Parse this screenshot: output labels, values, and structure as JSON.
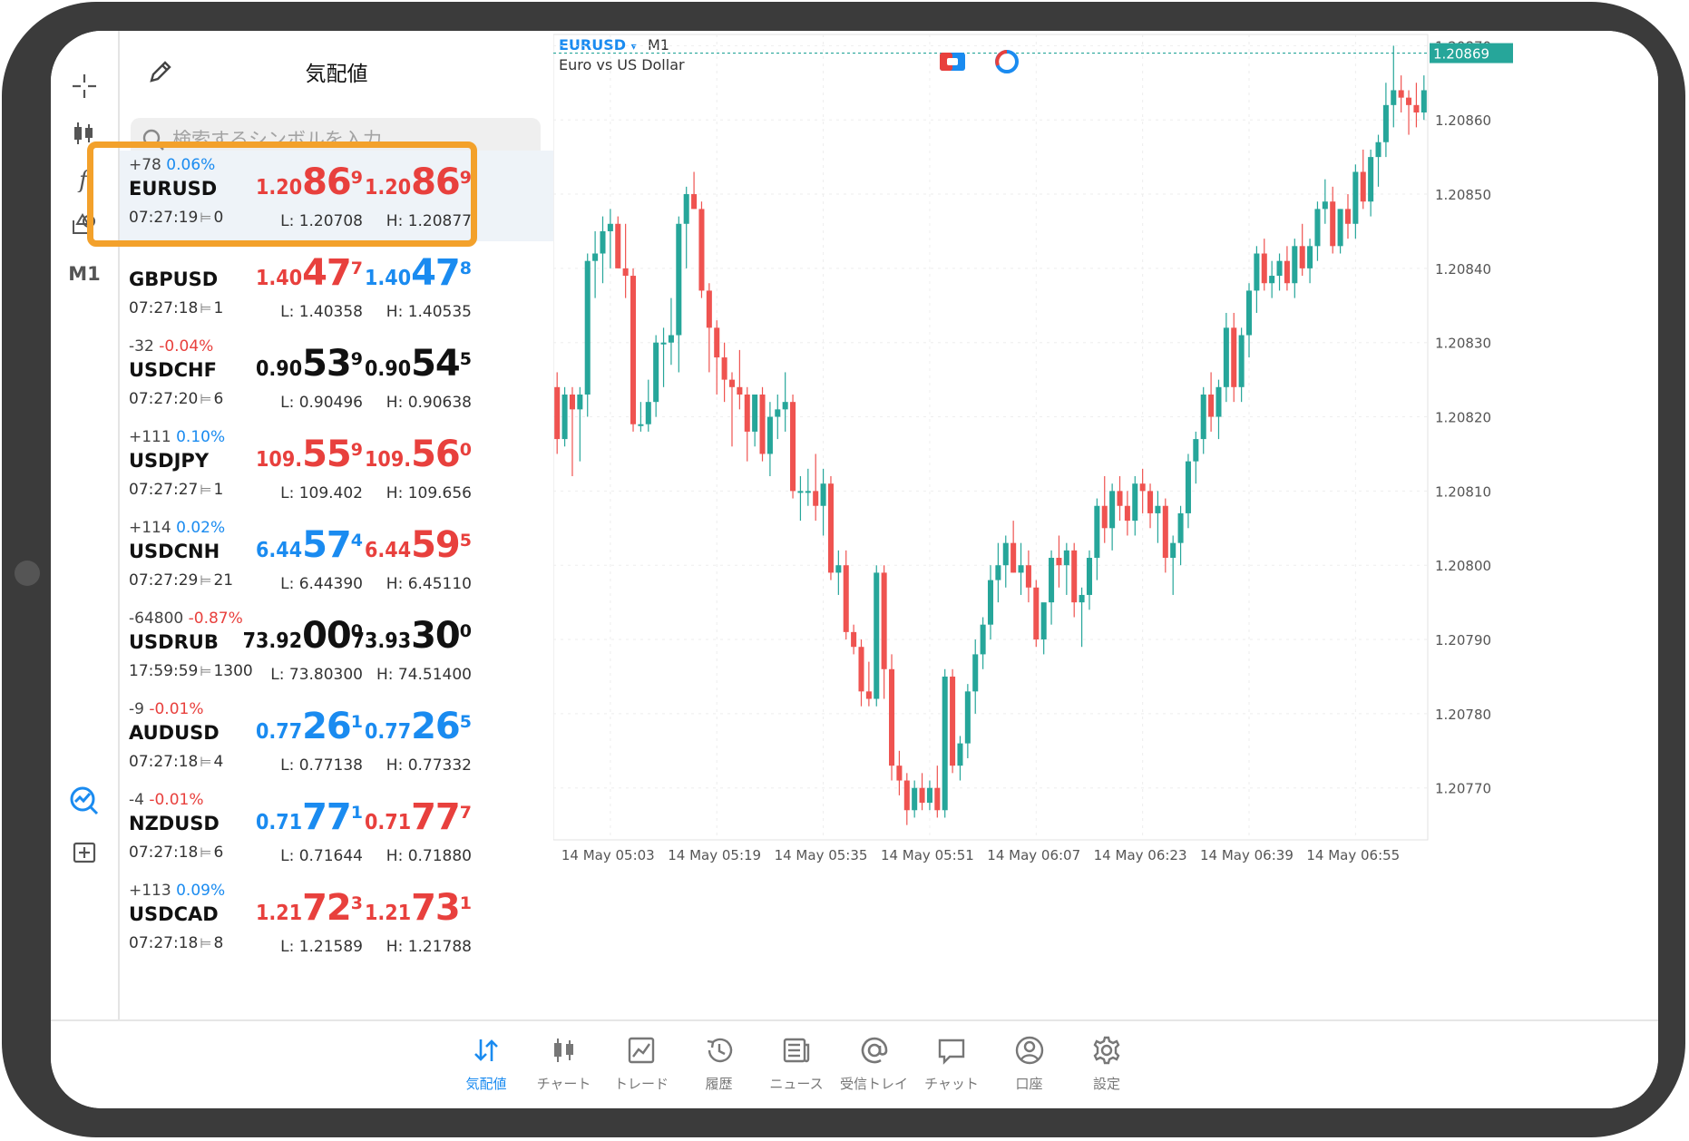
{
  "watchlist": {
    "title": "気配値",
    "search_placeholder": "検索するシンボルを入力",
    "selected": "EURUSD",
    "rows": [
      {
        "change_points": "+78",
        "change_pct": "0.06%",
        "pct_sign": "pos",
        "symbol": "EURUSD",
        "time": "07:27:19",
        "spread": "0",
        "bid_prefix": "1.20",
        "bid_big": "86",
        "bid_sup": "9",
        "bid_color": "red",
        "ask_prefix": "1.20",
        "ask_big": "86",
        "ask_sup": "9",
        "ask_color": "red",
        "low": "L: 1.20708",
        "high": "H: 1.20877"
      },
      {
        "change_points": "",
        "change_pct": "",
        "pct_sign": "neg",
        "symbol": "GBPUSD",
        "time": "07:27:18",
        "spread": "1",
        "bid_prefix": "1.40",
        "bid_big": "47",
        "bid_sup": "7",
        "bid_color": "red",
        "ask_prefix": "1.40",
        "ask_big": "47",
        "ask_sup": "8",
        "ask_color": "blue",
        "low": "L: 1.40358",
        "high": "H: 1.40535"
      },
      {
        "change_points": "-32",
        "change_pct": "-0.04%",
        "pct_sign": "neg",
        "symbol": "USDCHF",
        "time": "07:27:20",
        "spread": "6",
        "bid_prefix": "0.90",
        "bid_big": "53",
        "bid_sup": "9",
        "bid_color": "black",
        "ask_prefix": "0.90",
        "ask_big": "54",
        "ask_sup": "5",
        "ask_color": "black",
        "low": "L: 0.90496",
        "high": "H: 0.90638"
      },
      {
        "change_points": "+111",
        "change_pct": "0.10%",
        "pct_sign": "pos",
        "symbol": "USDJPY",
        "time": "07:27:27",
        "spread": "1",
        "bid_prefix": "109.",
        "bid_big": "55",
        "bid_sup": "9",
        "bid_color": "red",
        "ask_prefix": "109.",
        "ask_big": "56",
        "ask_sup": "0",
        "ask_color": "red",
        "low": "L: 109.402",
        "high": "H: 109.656"
      },
      {
        "change_points": "+114",
        "change_pct": "0.02%",
        "pct_sign": "pos",
        "symbol": "USDCNH",
        "time": "07:27:29",
        "spread": "21",
        "bid_prefix": "6.44",
        "bid_big": "57",
        "bid_sup": "4",
        "bid_color": "blue",
        "ask_prefix": "6.44",
        "ask_big": "59",
        "ask_sup": "5",
        "ask_color": "red",
        "low": "L: 6.44390",
        "high": "H: 6.45110"
      },
      {
        "change_points": "-64800",
        "change_pct": "-0.87%",
        "pct_sign": "neg",
        "symbol": "USDRUB",
        "time": "17:59:59",
        "spread": "1300",
        "bid_prefix": "73.92",
        "bid_big": "00",
        "bid_sup": "0",
        "bid_color": "black",
        "ask_prefix": "73.93",
        "ask_big": "30",
        "ask_sup": "0",
        "ask_color": "black",
        "low": "L: 73.80300",
        "high": "H: 74.51400"
      },
      {
        "change_points": "-9",
        "change_pct": "-0.01%",
        "pct_sign": "neg",
        "symbol": "AUDUSD",
        "time": "07:27:18",
        "spread": "4",
        "bid_prefix": "0.77",
        "bid_big": "26",
        "bid_sup": "1",
        "bid_color": "blue",
        "ask_prefix": "0.77",
        "ask_big": "26",
        "ask_sup": "5",
        "ask_color": "blue",
        "low": "L: 0.77138",
        "high": "H: 0.77332"
      },
      {
        "change_points": "-4",
        "change_pct": "-0.01%",
        "pct_sign": "neg",
        "symbol": "NZDUSD",
        "time": "07:27:18",
        "spread": "6",
        "bid_prefix": "0.71",
        "bid_big": "77",
        "bid_sup": "1",
        "bid_color": "blue",
        "ask_prefix": "0.71",
        "ask_big": "77",
        "ask_sup": "7",
        "ask_color": "red",
        "low": "L: 0.71644",
        "high": "H: 0.71880"
      },
      {
        "change_points": "+113",
        "change_pct": "0.09%",
        "pct_sign": "pos",
        "symbol": "USDCAD",
        "time": "07:27:18",
        "spread": "8",
        "bid_prefix": "1.21",
        "bid_big": "72",
        "bid_sup": "3",
        "bid_color": "red",
        "ask_prefix": "1.21",
        "ask_big": "73",
        "ask_sup": "1",
        "ask_color": "red",
        "low": "L: 1.21589",
        "high": "H: 1.21788"
      }
    ]
  },
  "toolbar": {
    "timeframe": "M1"
  },
  "chart": {
    "symbol": "EURUSD",
    "symbol_arrow": "▾",
    "timeframe": "M1",
    "description": "Euro vs US Dollar",
    "current_price_label": "1.20869",
    "colors": {
      "up": "#26a69a",
      "down": "#ef5350",
      "last_line": "#26a69a"
    }
  },
  "chart_data": {
    "type": "candlestick",
    "ylim": [
      1.20763,
      1.20872
    ],
    "y_ticks": [
      "1.20870",
      "1.20860",
      "1.20850",
      "1.20840",
      "1.20830",
      "1.20820",
      "1.20810",
      "1.20800",
      "1.20790",
      "1.20780",
      "1.20770"
    ],
    "x_ticks": [
      "14 May 05:03",
      "14 May 05:19",
      "14 May 05:35",
      "14 May 05:51",
      "14 May 06:07",
      "14 May 06:23",
      "14 May 06:39",
      "14 May 06:55"
    ],
    "last_price": 1.20869,
    "candles": [
      [
        1.20824,
        1.20826,
        1.20815,
        1.20817
      ],
      [
        1.20817,
        1.20824,
        1.20816,
        1.20823
      ],
      [
        1.20823,
        1.20824,
        1.20812,
        1.20821
      ],
      [
        1.20821,
        1.20824,
        1.20814,
        1.20823
      ],
      [
        1.20823,
        1.20842,
        1.2082,
        1.20841
      ],
      [
        1.20841,
        1.20845,
        1.20836,
        1.20842
      ],
      [
        1.20842,
        1.20847,
        1.20838,
        1.20845
      ],
      [
        1.20845,
        1.20848,
        1.2084,
        1.20846
      ],
      [
        1.20846,
        1.20847,
        1.2084,
        1.2084
      ],
      [
        1.2084,
        1.20846,
        1.20836,
        1.20839
      ],
      [
        1.20839,
        1.2084,
        1.20818,
        1.20819
      ],
      [
        1.20819,
        1.20822,
        1.20818,
        1.20819
      ],
      [
        1.20819,
        1.20825,
        1.20818,
        1.20822
      ],
      [
        1.20822,
        1.20831,
        1.2082,
        1.2083
      ],
      [
        1.2083,
        1.20832,
        1.20824,
        1.2083
      ],
      [
        1.2083,
        1.20836,
        1.20827,
        1.20831
      ],
      [
        1.20831,
        1.20847,
        1.20826,
        1.20846
      ],
      [
        1.20846,
        1.20851,
        1.2084,
        1.2085
      ],
      [
        1.2085,
        1.20853,
        1.20848,
        1.20848
      ],
      [
        1.20848,
        1.20849,
        1.20836,
        1.20837
      ],
      [
        1.20837,
        1.20838,
        1.20826,
        1.20832
      ],
      [
        1.20832,
        1.20833,
        1.20823,
        1.20828
      ],
      [
        1.20828,
        1.2083,
        1.20822,
        1.20825
      ],
      [
        1.20825,
        1.20826,
        1.20816,
        1.20824
      ],
      [
        1.20824,
        1.20829,
        1.20821,
        1.20823
      ],
      [
        1.20823,
        1.20824,
        1.20814,
        1.20818
      ],
      [
        1.20818,
        1.20822,
        1.20816,
        1.20823
      ],
      [
        1.20823,
        1.20824,
        1.20814,
        1.20815
      ],
      [
        1.20815,
        1.20822,
        1.20812,
        1.2082
      ],
      [
        1.2082,
        1.20823,
        1.20817,
        1.20821
      ],
      [
        1.20821,
        1.20826,
        1.20818,
        1.20822
      ],
      [
        1.20822,
        1.20823,
        1.20809,
        1.2081
      ],
      [
        1.2081,
        1.20812,
        1.20806,
        1.2081
      ],
      [
        1.2081,
        1.20813,
        1.20808,
        1.2081
      ],
      [
        1.2081,
        1.20815,
        1.20806,
        1.20808
      ],
      [
        1.20808,
        1.20813,
        1.20804,
        1.20811
      ],
      [
        1.20811,
        1.20812,
        1.20798,
        1.20799
      ],
      [
        1.20799,
        1.20802,
        1.20796,
        1.208
      ],
      [
        1.208,
        1.20802,
        1.2079,
        1.20791
      ],
      [
        1.20791,
        1.20792,
        1.20788,
        1.20789
      ],
      [
        1.20789,
        1.2079,
        1.20781,
        1.20783
      ],
      [
        1.20783,
        1.20787,
        1.20781,
        1.20782
      ],
      [
        1.20782,
        1.208,
        1.20781,
        1.20799
      ],
      [
        1.20799,
        1.208,
        1.20782,
        1.20786
      ],
      [
        1.20786,
        1.20788,
        1.20771,
        1.20773
      ],
      [
        1.20773,
        1.20775,
        1.20769,
        1.20771
      ],
      [
        1.20771,
        1.20772,
        1.20765,
        1.20767
      ],
      [
        1.20767,
        1.20771,
        1.20766,
        1.2077
      ],
      [
        1.2077,
        1.20772,
        1.20767,
        1.20768
      ],
      [
        1.20768,
        1.20771,
        1.20767,
        1.2077
      ],
      [
        1.2077,
        1.20773,
        1.20766,
        1.20767
      ],
      [
        1.20767,
        1.20786,
        1.20766,
        1.20785
      ],
      [
        1.20785,
        1.20786,
        1.20772,
        1.20773
      ],
      [
        1.20773,
        1.20777,
        1.20771,
        1.20776
      ],
      [
        1.20776,
        1.20784,
        1.20774,
        1.20783
      ],
      [
        1.20783,
        1.2079,
        1.2078,
        1.20788
      ],
      [
        1.20788,
        1.20793,
        1.20786,
        1.20792
      ],
      [
        1.20792,
        1.208,
        1.2079,
        1.20798
      ],
      [
        1.20798,
        1.20803,
        1.20795,
        1.208
      ],
      [
        1.208,
        1.20804,
        1.20797,
        1.20803
      ],
      [
        1.20803,
        1.20806,
        1.20799,
        1.20799
      ],
      [
        1.20799,
        1.20803,
        1.20796,
        1.208
      ],
      [
        1.208,
        1.20802,
        1.20795,
        1.20797
      ],
      [
        1.20797,
        1.20798,
        1.20789,
        1.2079
      ],
      [
        1.2079,
        1.20793,
        1.20788,
        1.20795
      ],
      [
        1.20795,
        1.20802,
        1.20792,
        1.20801
      ],
      [
        1.20801,
        1.20804,
        1.20797,
        1.208
      ],
      [
        1.208,
        1.20803,
        1.20796,
        1.20802
      ],
      [
        1.20802,
        1.20803,
        1.20793,
        1.20795
      ],
      [
        1.20795,
        1.20797,
        1.20789,
        1.20796
      ],
      [
        1.20796,
        1.20802,
        1.20794,
        1.20801
      ],
      [
        1.20801,
        1.20809,
        1.20798,
        1.20808
      ],
      [
        1.20808,
        1.20812,
        1.20803,
        1.20805
      ],
      [
        1.20805,
        1.20811,
        1.20802,
        1.2081
      ],
      [
        1.2081,
        1.20812,
        1.20806,
        1.20808
      ],
      [
        1.20808,
        1.2081,
        1.20804,
        1.20806
      ],
      [
        1.20806,
        1.20812,
        1.20804,
        1.20811
      ],
      [
        1.20811,
        1.20813,
        1.20807,
        1.2081
      ],
      [
        1.2081,
        1.20811,
        1.20805,
        1.20807
      ],
      [
        1.20807,
        1.2081,
        1.20803,
        1.20808
      ],
      [
        1.20808,
        1.20809,
        1.20799,
        1.20801
      ],
      [
        1.20801,
        1.20804,
        1.20796,
        1.20803
      ],
      [
        1.20803,
        1.20808,
        1.208,
        1.20807
      ],
      [
        1.20807,
        1.20815,
        1.20805,
        1.20814
      ],
      [
        1.20814,
        1.20818,
        1.20811,
        1.20817
      ],
      [
        1.20817,
        1.20824,
        1.20815,
        1.20823
      ],
      [
        1.20823,
        1.20826,
        1.20818,
        1.2082
      ],
      [
        1.2082,
        1.20825,
        1.20817,
        1.20824
      ],
      [
        1.20824,
        1.20834,
        1.20822,
        1.20832
      ],
      [
        1.20832,
        1.20834,
        1.20822,
        1.20824
      ],
      [
        1.20824,
        1.20832,
        1.20822,
        1.20831
      ],
      [
        1.20831,
        1.20838,
        1.20828,
        1.20837
      ],
      [
        1.20837,
        1.20843,
        1.20834,
        1.20842
      ],
      [
        1.20842,
        1.20844,
        1.20837,
        1.20838
      ],
      [
        1.20838,
        1.20841,
        1.20836,
        1.20839
      ],
      [
        1.20839,
        1.20842,
        1.20837,
        1.20841
      ],
      [
        1.20841,
        1.20843,
        1.20837,
        1.20838
      ],
      [
        1.20838,
        1.20844,
        1.20836,
        1.20843
      ],
      [
        1.20843,
        1.20846,
        1.20839,
        1.2084
      ],
      [
        1.2084,
        1.20844,
        1.20838,
        1.20843
      ],
      [
        1.20843,
        1.20849,
        1.20841,
        1.20848
      ],
      [
        1.20848,
        1.20852,
        1.20846,
        1.20849
      ],
      [
        1.20849,
        1.20851,
        1.20842,
        1.20843
      ],
      [
        1.20843,
        1.20848,
        1.20842,
        1.20848
      ],
      [
        1.20848,
        1.2085,
        1.20844,
        1.20846
      ],
      [
        1.20846,
        1.20854,
        1.20844,
        1.20853
      ],
      [
        1.20853,
        1.20856,
        1.20848,
        1.20849
      ],
      [
        1.20849,
        1.20856,
        1.20847,
        1.20855
      ],
      [
        1.20855,
        1.20858,
        1.20851,
        1.20857
      ],
      [
        1.20857,
        1.20865,
        1.20855,
        1.20862
      ],
      [
        1.20862,
        1.2087,
        1.20859,
        1.20864
      ],
      [
        1.20864,
        1.20866,
        1.20861,
        1.20863
      ],
      [
        1.20863,
        1.20864,
        1.20858,
        1.20862
      ],
      [
        1.20862,
        1.20865,
        1.20859,
        1.20861
      ],
      [
        1.20861,
        1.20866,
        1.2086,
        1.20864
      ]
    ]
  },
  "tabs": [
    {
      "id": "quotes",
      "label": "気配値",
      "active": true
    },
    {
      "id": "chart",
      "label": "チャート",
      "active": false
    },
    {
      "id": "trade",
      "label": "トレード",
      "active": false
    },
    {
      "id": "history",
      "label": "履歴",
      "active": false
    },
    {
      "id": "news",
      "label": "ニュース",
      "active": false
    },
    {
      "id": "mailbox",
      "label": "受信トレイ",
      "active": false
    },
    {
      "id": "chat",
      "label": "チャット",
      "active": false
    },
    {
      "id": "account",
      "label": "口座",
      "active": false
    },
    {
      "id": "settings",
      "label": "設定",
      "active": false
    }
  ]
}
